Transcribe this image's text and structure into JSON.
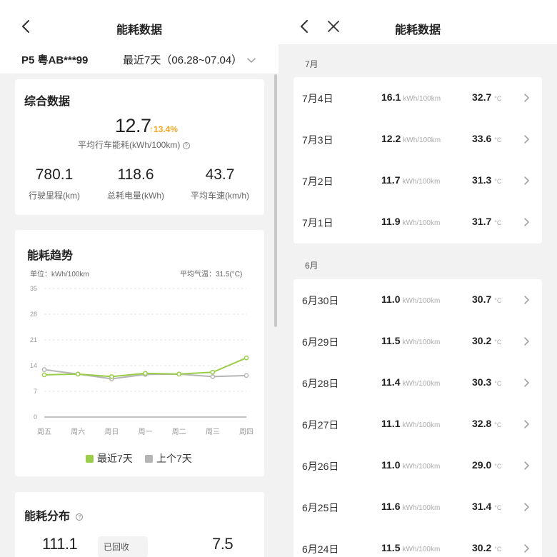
{
  "left": {
    "header": {
      "title": "能耗数据"
    },
    "filter": {
      "plate": "P5 粤AB***99",
      "range": "最近7天（06.28~07.04）"
    },
    "summary": {
      "title": "综合数据",
      "avg_value": "12.7",
      "change": "13.4%",
      "avg_label": "平均行车能耗(kWh/100km)",
      "stats": [
        {
          "value": "780.1",
          "label": "行驶里程(km)"
        },
        {
          "value": "118.6",
          "label": "总耗电量(kWh)"
        },
        {
          "value": "43.7",
          "label": "平均车速(km/h)"
        }
      ]
    },
    "trend": {
      "title": "能耗趋势",
      "unit_label": "单位：kWh/100km",
      "temp_label": "平均气温：31.5(°C)"
    },
    "distribution": {
      "title": "能耗分布",
      "left_value": "111.1",
      "badge": "已回收",
      "right_value": "7.5"
    }
  },
  "right": {
    "header": {
      "title": "能耗数据"
    },
    "months": [
      {
        "label": "7月",
        "rows": [
          {
            "date": "7月4日",
            "cons": "16.1",
            "temp": "32.7"
          },
          {
            "date": "7月3日",
            "cons": "12.2",
            "temp": "33.6"
          },
          {
            "date": "7月2日",
            "cons": "11.7",
            "temp": "31.3"
          },
          {
            "date": "7月1日",
            "cons": "11.9",
            "temp": "31.7"
          }
        ]
      },
      {
        "label": "6月",
        "rows": [
          {
            "date": "6月30日",
            "cons": "11.0",
            "temp": "30.7"
          },
          {
            "date": "6月29日",
            "cons": "11.5",
            "temp": "30.2"
          },
          {
            "date": "6月28日",
            "cons": "11.4",
            "temp": "30.3"
          },
          {
            "date": "6月27日",
            "cons": "11.1",
            "temp": "32.8"
          },
          {
            "date": "6月26日",
            "cons": "11.0",
            "temp": "29.0"
          },
          {
            "date": "6月25日",
            "cons": "11.6",
            "temp": "31.4"
          },
          {
            "date": "6月24日",
            "cons": "11.5",
            "temp": "30.2"
          }
        ]
      }
    ],
    "units": {
      "cons": "kWh/100km",
      "temp": "°C"
    }
  },
  "colors": {
    "accent_green": "#9acd4a",
    "previous_gray": "#b5b5b5",
    "change_orange": "#f5a623"
  },
  "chart_data": {
    "type": "line",
    "x": [
      "周五",
      "周六",
      "周日",
      "周一",
      "周二",
      "周三",
      "周四"
    ],
    "series": [
      {
        "name": "最近7天",
        "values": [
          11.5,
          11.7,
          11.0,
          11.9,
          11.7,
          12.2,
          16.1
        ]
      },
      {
        "name": "上个7天",
        "values": [
          12.9,
          11.7,
          10.4,
          11.6,
          11.7,
          11.0,
          11.3
        ]
      }
    ],
    "yticks": [
      0,
      7,
      14,
      21,
      28,
      35
    ],
    "ylim": [
      0,
      35
    ],
    "ylabel": "单位：kWh/100km",
    "grid": true,
    "legend": "bottom"
  }
}
